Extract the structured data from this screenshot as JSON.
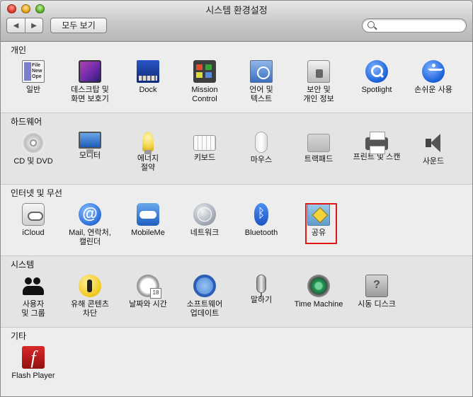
{
  "window": {
    "title": "시스템 환경설정"
  },
  "toolbar": {
    "back_icon": "back-arrow-icon",
    "forward_icon": "forward-arrow-icon",
    "show_all_label": "모두 보기",
    "search_placeholder": "",
    "search_icon": "magnifier-icon"
  },
  "sections": [
    {
      "title": "개인",
      "items": [
        {
          "label": [
            "일반"
          ],
          "icon": "general-icon",
          "icon_text": [
            "File",
            "New",
            "Ope"
          ]
        },
        {
          "label": [
            "데스크탑 및",
            "화면 보호기"
          ],
          "icon": "desktop-screensaver-icon"
        },
        {
          "label": [
            "Dock"
          ],
          "icon": "dock-icon"
        },
        {
          "label": [
            "Mission",
            "Control"
          ],
          "icon": "mission-control-icon"
        },
        {
          "label": [
            "언어 및",
            "텍스트"
          ],
          "icon": "language-text-icon"
        },
        {
          "label": [
            "보안 및",
            "개인 정보"
          ],
          "icon": "security-privacy-icon"
        },
        {
          "label": [
            "Spotlight"
          ],
          "icon": "spotlight-icon"
        },
        {
          "label": [
            "손쉬운 사용"
          ],
          "icon": "accessibility-icon"
        }
      ]
    },
    {
      "title": "하드웨어",
      "items": [
        {
          "label": [
            "CD 및 DVD"
          ],
          "icon": "cd-dvd-icon"
        },
        {
          "label": [
            "모니터"
          ],
          "icon": "monitor-icon"
        },
        {
          "label": [
            "에너지",
            "절약"
          ],
          "icon": "energy-saver-icon"
        },
        {
          "label": [
            "키보드"
          ],
          "icon": "keyboard-icon"
        },
        {
          "label": [
            "마우스"
          ],
          "icon": "mouse-icon"
        },
        {
          "label": [
            "트랙패드"
          ],
          "icon": "trackpad-icon"
        },
        {
          "label": [
            "프린트 및 스캔"
          ],
          "icon": "printer-icon"
        },
        {
          "label": [
            "사운드"
          ],
          "icon": "speaker-icon"
        }
      ]
    },
    {
      "title": "인터넷 및 무선",
      "items": [
        {
          "label": [
            "iCloud"
          ],
          "icon": "icloud-icon"
        },
        {
          "label": [
            "Mail, 연락처,",
            "캘린더"
          ],
          "icon": "mail-contacts-icon"
        },
        {
          "label": [
            "MobileMe"
          ],
          "icon": "mobileme-icon"
        },
        {
          "label": [
            "네트워크"
          ],
          "icon": "network-icon"
        },
        {
          "label": [
            "Bluetooth"
          ],
          "icon": "bluetooth-icon"
        },
        {
          "label": [
            "공유"
          ],
          "icon": "sharing-icon",
          "highlighted": true
        }
      ]
    },
    {
      "title": "시스템",
      "items": [
        {
          "label": [
            "사용자",
            "및 그룹"
          ],
          "icon": "users-groups-icon"
        },
        {
          "label": [
            "유해 콘텐츠",
            "차단"
          ],
          "icon": "parental-controls-icon"
        },
        {
          "label": [
            "날짜와 시간"
          ],
          "icon": "date-time-icon",
          "icon_text": [
            "18"
          ]
        },
        {
          "label": [
            "소프트웨어",
            "업데이트"
          ],
          "icon": "software-update-icon"
        },
        {
          "label": [
            "말하기"
          ],
          "icon": "microphone-icon"
        },
        {
          "label": [
            "Time Machine"
          ],
          "icon": "time-machine-icon"
        },
        {
          "label": [
            "시동 디스크"
          ],
          "icon": "startup-disk-icon"
        }
      ]
    },
    {
      "title": "기타",
      "items": [
        {
          "label": [
            "Flash Player"
          ],
          "icon": "flash-player-icon"
        }
      ]
    }
  ],
  "colors": {
    "highlight": "#e01818"
  }
}
